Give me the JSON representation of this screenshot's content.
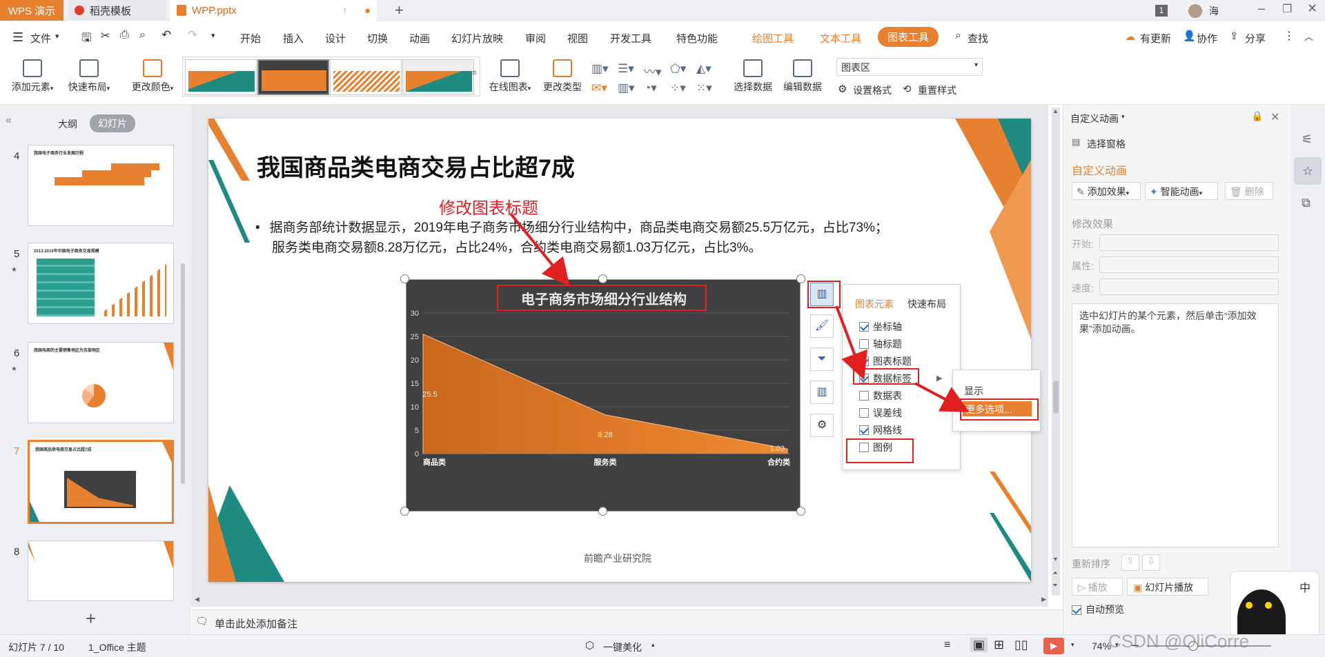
{
  "titlebar": {
    "app_tab": "WPS 演示",
    "doc_tab": "稻壳模板",
    "file_tab": "WPP.pptx",
    "page_badge": "1",
    "user": "海"
  },
  "menu": {
    "file": "文件",
    "items": [
      "开始",
      "插入",
      "设计",
      "切换",
      "动画",
      "幻灯片放映",
      "审阅",
      "视图",
      "开发工具",
      "特色功能"
    ],
    "ctx_tabs": [
      "绘图工具",
      "文本工具",
      "图表工具"
    ],
    "search": "查找",
    "update": "有更新",
    "collab": "协作",
    "share": "分享"
  },
  "ribbon": {
    "add_element": "添加元素",
    "quick_layout": "快速布局",
    "change_color": "更改颜色",
    "online_chart": "在线图表",
    "change_type": "更改类型",
    "select_data": "选择数据",
    "edit_data": "编辑数据",
    "chart_area": "图表区",
    "set_format": "设置格式",
    "reset_style": "重置样式"
  },
  "leftpanel": {
    "outline_tab": "大纲",
    "slides_tab": "幻灯片",
    "slide_numbers": [
      "4",
      "5",
      "6",
      "7",
      "8"
    ],
    "th4_title": "我国电子商务行业发展历程",
    "th5_title": "2013-2019年中国电子商务交易规模",
    "th6_title": "我国电商的主要销售地区为东部地区",
    "th7_title": "我国商品类电商交易占比超7成"
  },
  "slide": {
    "title": "我国商品类电商交易占比超7成",
    "annotation": "修改图表标题",
    "bullet_line1": "据商务部统计数据显示，2019年电子商务市场细分行业结构中，商品类电商交易额25.5万亿元，占比73%；",
    "bullet_line2": "服务类电商交易额8.28万亿元，占比24%，合约类电商交易额1.03万亿元，占比3%。",
    "source": "前瞻产业研究院"
  },
  "chart_data": {
    "type": "area",
    "title": "电子商务市场细分行业结构",
    "categories": [
      "商品类",
      "服务类",
      "合约类"
    ],
    "values": [
      25.5,
      8.28,
      1.03
    ],
    "data_labels": [
      "25.5",
      "8.28",
      "1.03"
    ],
    "ylim": [
      0,
      30
    ],
    "yticks": [
      0,
      5,
      10,
      15,
      20,
      25,
      30
    ],
    "grid": true,
    "legend": false,
    "colors": {
      "fill": "#e8812f",
      "background": "#404040"
    }
  },
  "chart_elements": {
    "tab_elements": "图表元素",
    "tab_quick": "快速布局",
    "items": [
      {
        "label": "坐标轴",
        "checked": true
      },
      {
        "label": "轴标题",
        "checked": false
      },
      {
        "label": "图表标题",
        "checked": true
      },
      {
        "label": "数据标签",
        "checked": true
      },
      {
        "label": "数据表",
        "checked": false
      },
      {
        "label": "误差线",
        "checked": false
      },
      {
        "label": "网格线",
        "checked": true
      },
      {
        "label": "图例",
        "checked": false
      }
    ],
    "submenu": {
      "show": "显示",
      "more": "更多选项..."
    }
  },
  "rightpanel": {
    "header": "自定义动画",
    "select_pane": "选择窗格",
    "section_title": "自定义动画",
    "add_effect": "添加效果",
    "smart_anim": "智能动画",
    "delete": "删除",
    "modify_effect": "修改效果",
    "start": "开始:",
    "property": "属性:",
    "speed": "速度:",
    "hint": "选中幻灯片的某个元素，然后单击“添加效果”添加动画。",
    "reorder": "重新排序",
    "play": "播放",
    "slideshow": "幻灯片播放",
    "auto_preview": "自动预览"
  },
  "notes": {
    "placeholder": "单击此处添加备注"
  },
  "status": {
    "slide_pos": "幻灯片 7 / 10",
    "theme": "1_Office 主题",
    "beautify": "一键美化",
    "zoom": "74%",
    "watermark": "CSDN @OliCorre"
  },
  "colors": {
    "accent": "#e8812f",
    "teal": "#1f8a80",
    "red_annot": "#e02020"
  }
}
